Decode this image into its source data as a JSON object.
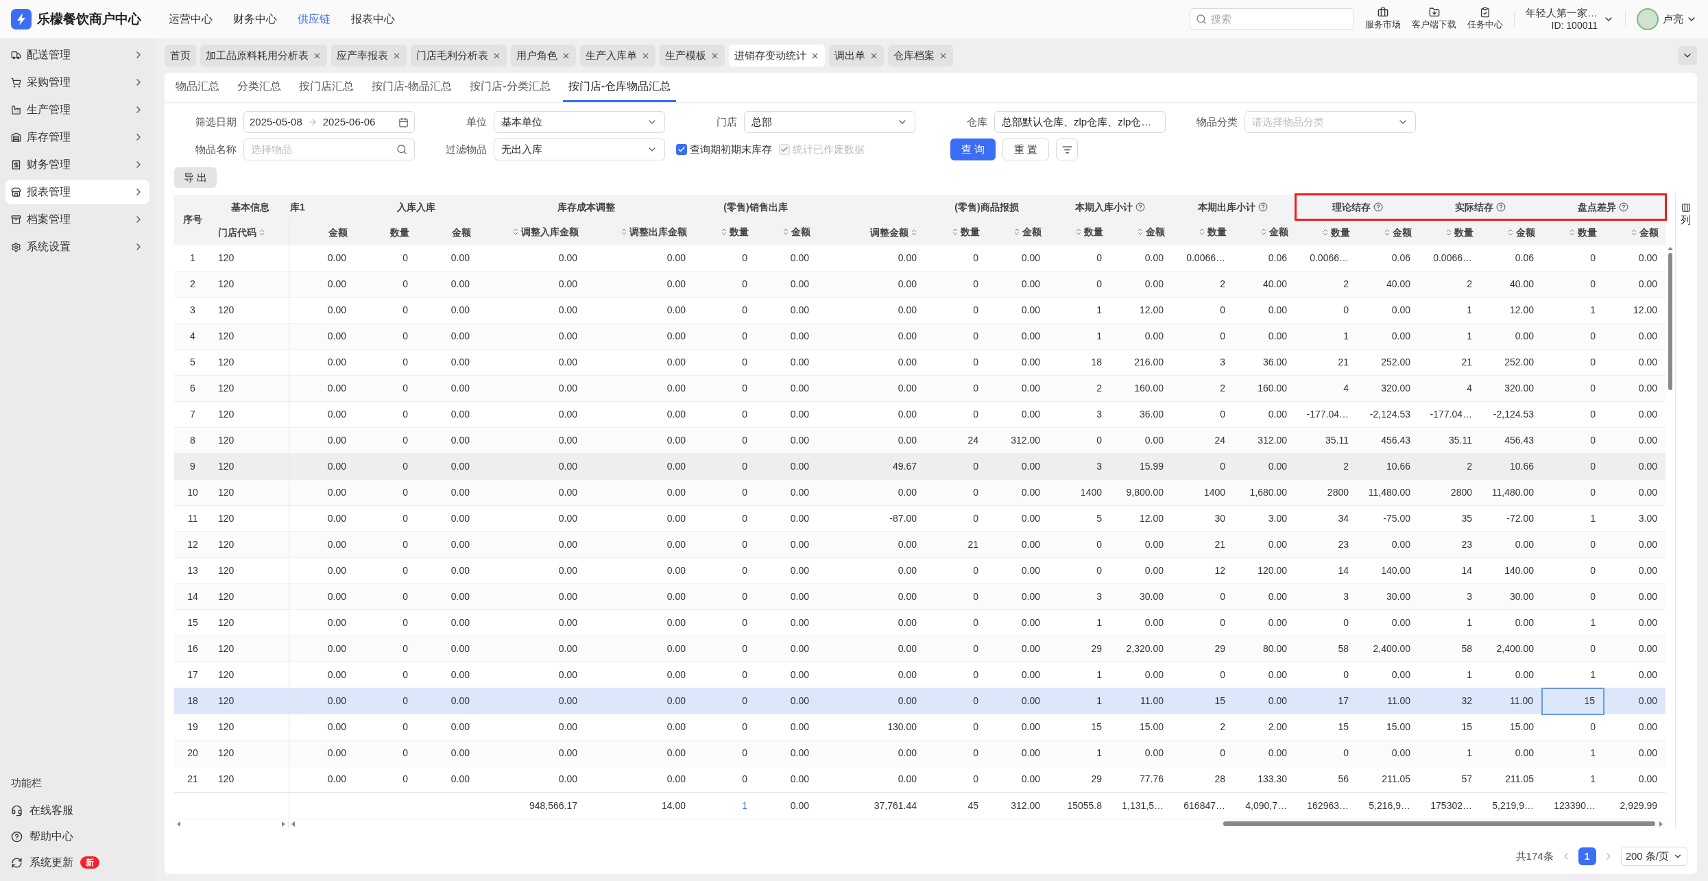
{
  "app": {
    "title": "乐檬餐饮商户中心"
  },
  "top_nav": [
    {
      "label": "运营中心",
      "selected": false
    },
    {
      "label": "财务中心",
      "selected": false
    },
    {
      "label": "供应链",
      "selected": true
    },
    {
      "label": "报表中心",
      "selected": false
    }
  ],
  "search": {
    "placeholder": "搜索"
  },
  "shortcuts": [
    "服务市场",
    "客户端下载",
    "任务中心"
  ],
  "account": {
    "name": "年轻人第一家…",
    "id": "ID: 100011"
  },
  "user": {
    "name": "卢亮"
  },
  "sidebar": {
    "items": [
      {
        "label": "配送管理",
        "selected": false
      },
      {
        "label": "采购管理",
        "selected": false
      },
      {
        "label": "生产管理",
        "selected": false
      },
      {
        "label": "库存管理",
        "selected": false
      },
      {
        "label": "财务管理",
        "selected": false
      },
      {
        "label": "报表管理",
        "selected": true
      },
      {
        "label": "档案管理",
        "selected": false
      },
      {
        "label": "系统设置",
        "selected": false
      }
    ],
    "footer_title": "功能栏",
    "footer_items": [
      {
        "label": "在线客服"
      },
      {
        "label": "帮助中心"
      },
      {
        "label": "系统更新",
        "badge": "新"
      }
    ]
  },
  "tabs": [
    {
      "label": "首页",
      "closable": false,
      "selected": false
    },
    {
      "label": "加工品原料耗用分析表",
      "closable": true,
      "selected": false
    },
    {
      "label": "应产率报表",
      "closable": true,
      "selected": false
    },
    {
      "label": "门店毛利分析表",
      "closable": true,
      "selected": false
    },
    {
      "label": "用户角色",
      "closable": true,
      "selected": false
    },
    {
      "label": "生产入库单",
      "closable": true,
      "selected": false
    },
    {
      "label": "生产模板",
      "closable": true,
      "selected": false
    },
    {
      "label": "进销存变动统计",
      "closable": true,
      "selected": true
    },
    {
      "label": "调出单",
      "closable": true,
      "selected": false
    },
    {
      "label": "仓库档案",
      "closable": true,
      "selected": false
    }
  ],
  "sub_tabs": [
    {
      "label": "物品汇总",
      "selected": false
    },
    {
      "label": "分类汇总",
      "selected": false
    },
    {
      "label": "按门店汇总",
      "selected": false
    },
    {
      "label": "按门店-物品汇总",
      "selected": false
    },
    {
      "label": "按门店-分类汇总",
      "selected": false
    },
    {
      "label": "按门店-仓库物品汇总",
      "selected": true
    }
  ],
  "filters": {
    "date": {
      "label": "筛选日期",
      "start": "2025-05-08",
      "end": "2025-06-06"
    },
    "unit": {
      "label": "单位",
      "value": "基本单位"
    },
    "store": {
      "label": "门店",
      "value": "总部"
    },
    "warehouse": {
      "label": "仓库",
      "value": "总部默认仓库、zlp仓库、zlp仓…"
    },
    "category": {
      "label": "物品分类",
      "placeholder": "请选择物品分类"
    },
    "item_name": {
      "label": "物品名称",
      "placeholder": "选择物品"
    },
    "item_filter": {
      "label": "过滤物品",
      "value": "无出入库"
    },
    "checkboxes": [
      {
        "label": "查询期初期末库存",
        "checked": true,
        "disabled": false
      },
      {
        "label": "统计已作废数据",
        "checked": true,
        "disabled": true
      }
    ],
    "buttons": [
      {
        "label": "查 询",
        "kind": "primary"
      },
      {
        "label": "重 置",
        "kind": "default"
      }
    ]
  },
  "export_button": "导 出",
  "table": {
    "index_header": "序号",
    "groups": [
      {
        "label": "基本信息",
        "columns": [
          {
            "label": "门店代码",
            "sort_after": true,
            "left_aligned": true
          }
        ]
      },
      {
        "label": "库1",
        "left_aligned": true,
        "columns": [
          {
            "label": "金额"
          }
        ]
      },
      {
        "label": "入库入库",
        "columns": [
          {
            "label": "数量"
          },
          {
            "label": "金额"
          }
        ]
      },
      {
        "label": "库存成本调整",
        "columns": [
          {
            "label": "调整入库金额",
            "sort_before": true
          },
          {
            "label": "调整出库金额",
            "sort_before": true
          }
        ]
      },
      {
        "label": "(零售)销售出库",
        "columns": [
          {
            "label": "数量",
            "sort_before": true
          },
          {
            "label": "金额",
            "sort_before": true
          }
        ]
      },
      {
        "columns": [
          {
            "label": "调整金额",
            "sort_after": true
          }
        ]
      },
      {
        "label": "(零售)商品报损",
        "columns": [
          {
            "label": "数量",
            "sort_before": true
          },
          {
            "label": "金额",
            "sort_before": true
          }
        ]
      },
      {
        "label": "本期入库小计",
        "help": true,
        "columns": [
          {
            "label": "数量",
            "sort_before": true
          },
          {
            "label": "金额",
            "sort_before": true
          }
        ]
      },
      {
        "label": "本期出库小计",
        "help": true,
        "columns": [
          {
            "label": "数量",
            "sort_before": true
          },
          {
            "label": "金额",
            "sort_before": true
          }
        ]
      },
      {
        "label": "理论结存",
        "help": true,
        "highlighted": true,
        "columns": [
          {
            "label": "数量",
            "sort_before": true
          },
          {
            "label": "金额",
            "sort_before": true
          }
        ]
      },
      {
        "label": "实际结存",
        "help": true,
        "highlighted": true,
        "columns": [
          {
            "label": "数量",
            "sort_before": true
          },
          {
            "label": "金额",
            "sort_before": true
          }
        ]
      },
      {
        "label": "盘点差异",
        "help": true,
        "highlighted": true,
        "columns": [
          {
            "label": "数量",
            "sort_before": true
          },
          {
            "label": "金额",
            "sort_before": true
          }
        ]
      }
    ],
    "rows": [
      {
        "no": "1",
        "selected": false,
        "hovered": false,
        "cells": [
          "120",
          "0.00",
          "0",
          "0.00",
          "0.00",
          "0.00",
          "0",
          "0.00",
          "0.00",
          "0",
          "0.00",
          "0",
          "0.00",
          "0.0066…",
          "0.06",
          "0.0066…",
          "0.06",
          "0.0066…",
          "0.06",
          "0",
          "0.00"
        ]
      },
      {
        "no": "2",
        "selected": false,
        "hovered": false,
        "cells": [
          "120",
          "0.00",
          "0",
          "0.00",
          "0.00",
          "0.00",
          "0",
          "0.00",
          "0.00",
          "0",
          "0.00",
          "0",
          "0.00",
          "2",
          "40.00",
          "2",
          "40.00",
          "2",
          "40.00",
          "0",
          "0.00"
        ]
      },
      {
        "no": "3",
        "selected": false,
        "hovered": false,
        "cells": [
          "120",
          "0.00",
          "0",
          "0.00",
          "0.00",
          "0.00",
          "0",
          "0.00",
          "0.00",
          "0",
          "0.00",
          "1",
          "12.00",
          "0",
          "0.00",
          "0",
          "0.00",
          "1",
          "12.00",
          "1",
          "12.00"
        ]
      },
      {
        "no": "4",
        "selected": false,
        "hovered": false,
        "cells": [
          "120",
          "0.00",
          "0",
          "0.00",
          "0.00",
          "0.00",
          "0",
          "0.00",
          "0.00",
          "0",
          "0.00",
          "1",
          "0.00",
          "0",
          "0.00",
          "1",
          "0.00",
          "1",
          "0.00",
          "0",
          "0.00"
        ]
      },
      {
        "no": "5",
        "selected": false,
        "hovered": false,
        "cells": [
          "120",
          "0.00",
          "0",
          "0.00",
          "0.00",
          "0.00",
          "0",
          "0.00",
          "0.00",
          "0",
          "0.00",
          "18",
          "216.00",
          "3",
          "36.00",
          "21",
          "252.00",
          "21",
          "252.00",
          "0",
          "0.00"
        ]
      },
      {
        "no": "6",
        "selected": false,
        "hovered": false,
        "cells": [
          "120",
          "0.00",
          "0",
          "0.00",
          "0.00",
          "0.00",
          "0",
          "0.00",
          "0.00",
          "0",
          "0.00",
          "2",
          "160.00",
          "2",
          "160.00",
          "4",
          "320.00",
          "4",
          "320.00",
          "0",
          "0.00"
        ]
      },
      {
        "no": "7",
        "selected": false,
        "hovered": false,
        "cells": [
          "120",
          "0.00",
          "0",
          "0.00",
          "0.00",
          "0.00",
          "0",
          "0.00",
          "0.00",
          "0",
          "0.00",
          "3",
          "36.00",
          "0",
          "0.00",
          "-177.04…",
          "-2,124.53",
          "-177.04…",
          "-2,124.53",
          "0",
          "0.00"
        ]
      },
      {
        "no": "8",
        "selected": false,
        "hovered": false,
        "cells": [
          "120",
          "0.00",
          "0",
          "0.00",
          "0.00",
          "0.00",
          "0",
          "0.00",
          "0.00",
          "24",
          "312.00",
          "0",
          "0.00",
          "24",
          "312.00",
          "35.11",
          "456.43",
          "35.11",
          "456.43",
          "0",
          "0.00"
        ]
      },
      {
        "no": "9",
        "selected": false,
        "hovered": true,
        "cells": [
          "120",
          "0.00",
          "0",
          "0.00",
          "0.00",
          "0.00",
          "0",
          "0.00",
          "49.67",
          "0",
          "0.00",
          "3",
          "15.99",
          "0",
          "0.00",
          "2",
          "10.66",
          "2",
          "10.66",
          "0",
          "0.00"
        ]
      },
      {
        "no": "10",
        "selected": false,
        "hovered": false,
        "cells": [
          "120",
          "0.00",
          "0",
          "0.00",
          "0.00",
          "0.00",
          "0",
          "0.00",
          "0.00",
          "0",
          "0.00",
          "1400",
          "9,800.00",
          "1400",
          "1,680.00",
          "2800",
          "11,480.00",
          "2800",
          "11,480.00",
          "0",
          "0.00"
        ]
      },
      {
        "no": "11",
        "selected": false,
        "hovered": false,
        "cells": [
          "120",
          "0.00",
          "0",
          "0.00",
          "0.00",
          "0.00",
          "0",
          "0.00",
          "-87.00",
          "0",
          "0.00",
          "5",
          "12.00",
          "30",
          "3.00",
          "34",
          "-75.00",
          "35",
          "-72.00",
          "1",
          "3.00"
        ]
      },
      {
        "no": "12",
        "selected": false,
        "hovered": false,
        "cells": [
          "120",
          "0.00",
          "0",
          "0.00",
          "0.00",
          "0.00",
          "0",
          "0.00",
          "0.00",
          "21",
          "0.00",
          "0",
          "0.00",
          "21",
          "0.00",
          "23",
          "0.00",
          "23",
          "0.00",
          "0",
          "0.00"
        ]
      },
      {
        "no": "13",
        "selected": false,
        "hovered": false,
        "cells": [
          "120",
          "0.00",
          "0",
          "0.00",
          "0.00",
          "0.00",
          "0",
          "0.00",
          "0.00",
          "0",
          "0.00",
          "0",
          "0.00",
          "12",
          "120.00",
          "14",
          "140.00",
          "14",
          "140.00",
          "0",
          "0.00"
        ]
      },
      {
        "no": "14",
        "selected": false,
        "hovered": false,
        "cells": [
          "120",
          "0.00",
          "0",
          "0.00",
          "0.00",
          "0.00",
          "0",
          "0.00",
          "0.00",
          "0",
          "0.00",
          "3",
          "30.00",
          "0",
          "0.00",
          "3",
          "30.00",
          "3",
          "30.00",
          "0",
          "0.00"
        ]
      },
      {
        "no": "15",
        "selected": false,
        "hovered": false,
        "cells": [
          "120",
          "0.00",
          "0",
          "0.00",
          "0.00",
          "0.00",
          "0",
          "0.00",
          "0.00",
          "0",
          "0.00",
          "1",
          "0.00",
          "0",
          "0.00",
          "0",
          "0.00",
          "1",
          "0.00",
          "1",
          "0.00"
        ]
      },
      {
        "no": "16",
        "selected": false,
        "hovered": false,
        "cells": [
          "120",
          "0.00",
          "0",
          "0.00",
          "0.00",
          "0.00",
          "0",
          "0.00",
          "0.00",
          "0",
          "0.00",
          "29",
          "2,320.00",
          "29",
          "80.00",
          "58",
          "2,400.00",
          "58",
          "2,400.00",
          "0",
          "0.00"
        ]
      },
      {
        "no": "17",
        "selected": false,
        "hovered": false,
        "cells": [
          "120",
          "0.00",
          "0",
          "0.00",
          "0.00",
          "0.00",
          "0",
          "0.00",
          "0.00",
          "0",
          "0.00",
          "1",
          "0.00",
          "0",
          "0.00",
          "0",
          "0.00",
          "1",
          "0.00",
          "1",
          "0.00"
        ]
      },
      {
        "no": "18",
        "selected": true,
        "hovered": false,
        "cells": [
          "120",
          "0.00",
          "0",
          "0.00",
          "0.00",
          "0.00",
          "0",
          "0.00",
          "0.00",
          "0",
          "0.00",
          "1",
          "11.00",
          "15",
          "0.00",
          "17",
          "11.00",
          "32",
          "11.00",
          {
            "text": "15",
            "focused": true
          },
          "0.00"
        ]
      },
      {
        "no": "19",
        "selected": false,
        "hovered": false,
        "cells": [
          "120",
          "0.00",
          "0",
          "0.00",
          "0.00",
          "0.00",
          "0",
          "0.00",
          "130.00",
          "0",
          "0.00",
          "15",
          "15.00",
          "2",
          "2.00",
          "15",
          "15.00",
          "15",
          "15.00",
          "0",
          "0.00"
        ]
      },
      {
        "no": "20",
        "selected": false,
        "hovered": false,
        "cells": [
          "120",
          "0.00",
          "0",
          "0.00",
          "0.00",
          "0.00",
          "0",
          "0.00",
          "0.00",
          "0",
          "0.00",
          "1",
          "0.00",
          "0",
          "0.00",
          "0",
          "0.00",
          "1",
          "0.00",
          "1",
          "0.00"
        ]
      },
      {
        "no": "21",
        "selected": false,
        "hovered": false,
        "cells": [
          "120",
          "0.00",
          "0",
          "0.00",
          "0.00",
          "0.00",
          "0",
          "0.00",
          "0.00",
          "0",
          "0.00",
          "29",
          "77.76",
          "28",
          "133.30",
          "56",
          "211.05",
          "57",
          "211.05",
          "1",
          "0.00"
        ]
      }
    ],
    "totals": [
      "948,566.17",
      "14.00",
      {
        "text": "1",
        "kind": "link"
      },
      "0.00",
      "37,761.44",
      "45",
      "312.00",
      "15055.8",
      "1,131,5…",
      "616847…",
      "4,090,7…",
      "162963…",
      "5,216,9…",
      "175302…",
      "5,219,9…",
      "123390…",
      "2,929.99"
    ],
    "column_settings": "列"
  },
  "pagination": {
    "total": "共174条",
    "pages": [
      {
        "label": "1",
        "selected": true
      }
    ],
    "page_size": "200 条/页"
  }
}
